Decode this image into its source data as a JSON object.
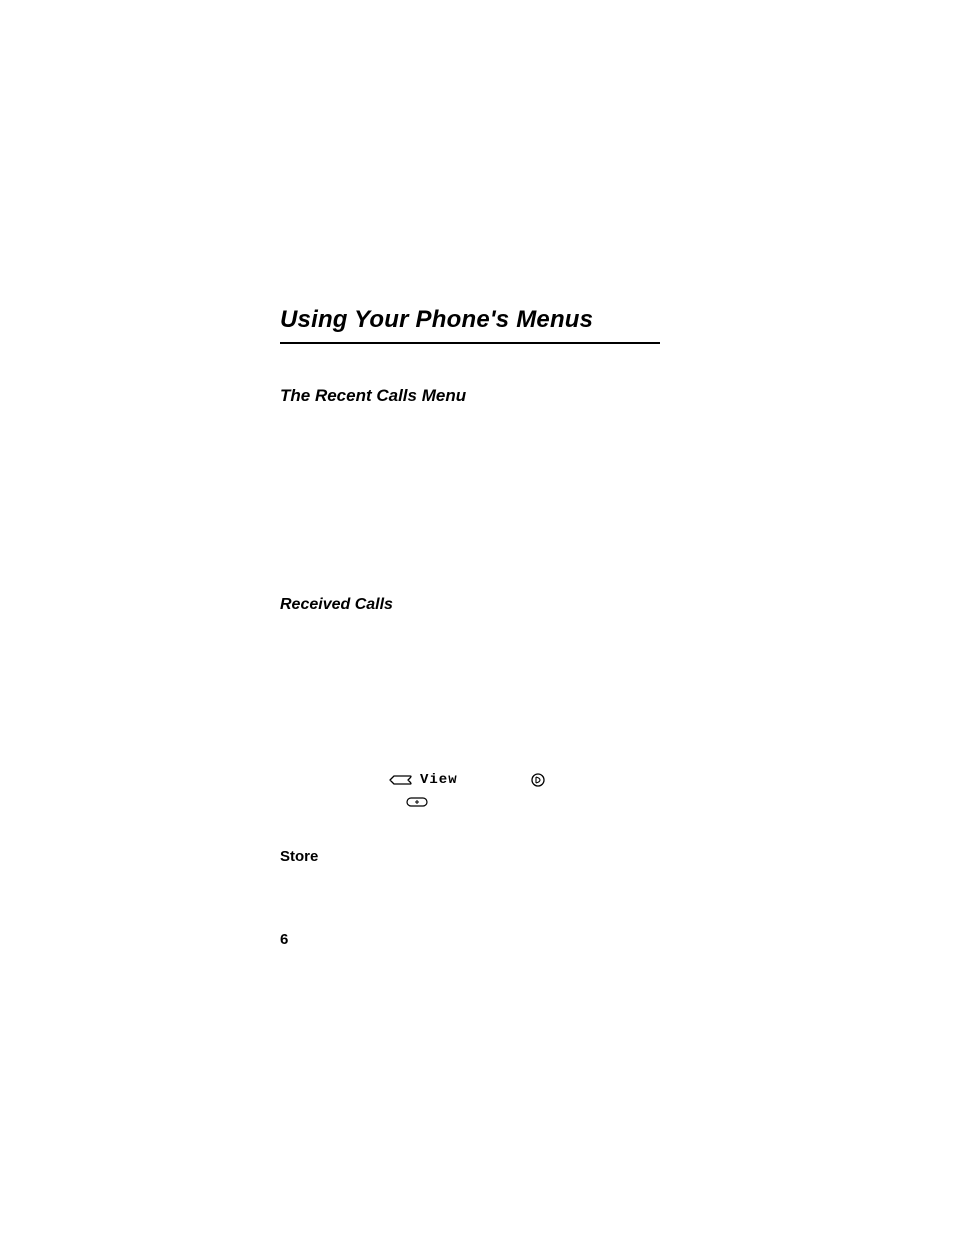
{
  "chapter": {
    "title": "Using Your Phone's Menus"
  },
  "section": {
    "title": "The Recent Calls Menu"
  },
  "subsection": {
    "title": "Received Calls"
  },
  "inline": {
    "view_label": "View",
    "store_label": "Store"
  },
  "footer": {
    "page_number": "6"
  }
}
